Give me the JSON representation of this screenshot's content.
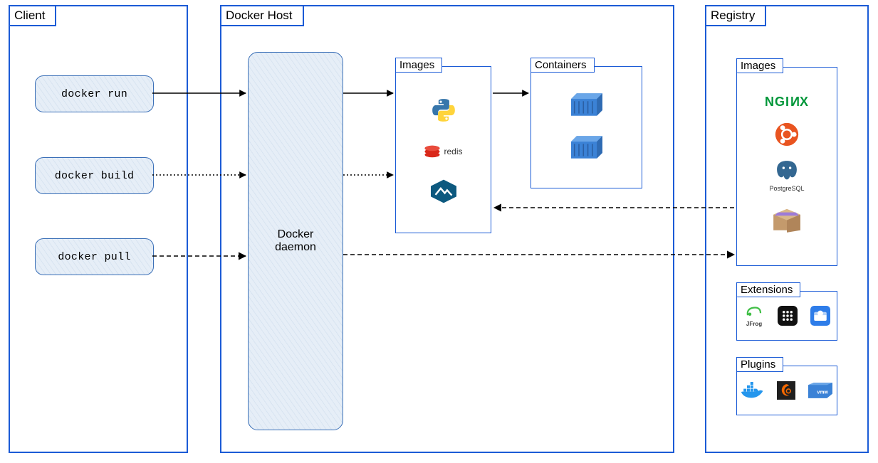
{
  "client": {
    "title": "Client",
    "commands": [
      "docker run",
      "docker build",
      "docker pull"
    ]
  },
  "host": {
    "title": "Docker Host",
    "daemon_label": "Docker\ndaemon",
    "images_label": "Images",
    "containers_label": "Containers",
    "images": [
      "python",
      "redis",
      "alpine"
    ]
  },
  "registry": {
    "title": "Registry",
    "images_label": "Images",
    "extensions_label": "Extensions",
    "plugins_label": "Plugins",
    "images": [
      "nginx",
      "ubuntu",
      "postgresql",
      "package"
    ],
    "extensions": [
      "jfrog",
      "portainer",
      "snyk"
    ],
    "plugins": [
      "docker-sbom",
      "grafana",
      "vmware"
    ]
  },
  "colors": {
    "border": "#1b5bd6",
    "cmd_bg": "#e6eef7"
  }
}
